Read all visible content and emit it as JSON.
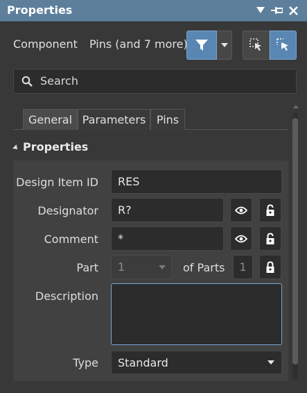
{
  "title": "Properties",
  "toolbar": {
    "mode_label": "Component",
    "filter_summary": "Pins (and 7 more)"
  },
  "search": {
    "placeholder": "Search"
  },
  "tabs": [
    "General",
    "Parameters",
    "Pins"
  ],
  "active_tab": "General",
  "section": {
    "title": "Properties"
  },
  "fields": {
    "design_item_id": {
      "label": "Design Item ID",
      "value": "RES"
    },
    "designator": {
      "label": "Designator",
      "value": "R?"
    },
    "comment": {
      "label": "Comment",
      "value": "*"
    },
    "part": {
      "label": "Part",
      "value": "1",
      "of_parts_label": "of Parts",
      "of_parts_value": "1"
    },
    "description": {
      "label": "Description",
      "value": ""
    },
    "type": {
      "label": "Type",
      "value": "Standard"
    }
  },
  "colors": {
    "titlebar": "#5e7f9c",
    "accent": "#5a86b3",
    "panel": "#383838"
  },
  "icons": [
    "pin-panel-icon",
    "close-icon",
    "dropdown-arrow-icon",
    "filter-icon",
    "select-mode-icon",
    "select-arrow-icon",
    "search-icon",
    "eye-icon",
    "lock-icon"
  ]
}
